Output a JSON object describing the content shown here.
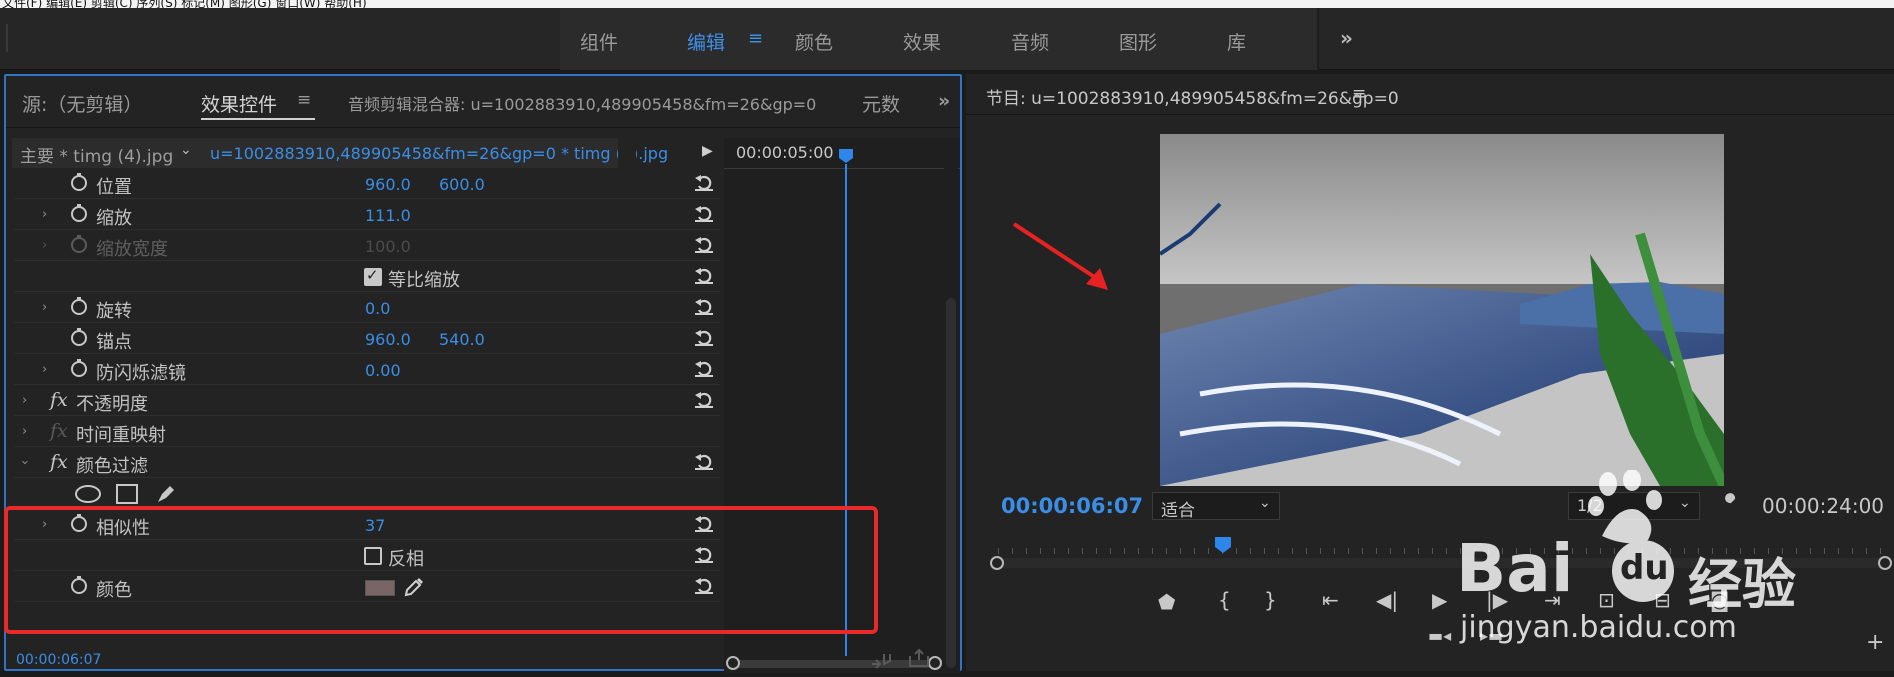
{
  "menubar": {
    "text": "文件(F) 编辑(E) 剪辑(C) 序列(S) 标记(M) 图形(G) 窗口(W) 帮助(H)"
  },
  "workspaces": [
    {
      "label": "组件"
    },
    {
      "label": "编辑",
      "active": true
    },
    {
      "label": "颜色"
    },
    {
      "label": "效果"
    },
    {
      "label": "音频"
    },
    {
      "label": "图形"
    },
    {
      "label": "库"
    }
  ],
  "left_panel": {
    "tabs": {
      "source": "源:（无剪辑）",
      "effect_controls": "效果控件",
      "audio_mixer": "音频剪辑混合器: u=1002883910,489905458&fm=26&gp=0",
      "metadata": "元数"
    },
    "clip": {
      "master": "主要 * timg (4).jpg",
      "sequence": "u=1002883910,489905458&fm=26&gp=0 * timg (4).jpg"
    },
    "timeline_time": "00:00:05:00",
    "rows": [
      {
        "label": "位置",
        "v1": "960.0",
        "v2": "600.0"
      },
      {
        "label": "缩放",
        "v1": "111.0"
      },
      {
        "label": "缩放宽度",
        "v1": "100.0"
      },
      {
        "checkbox_label": "等比缩放"
      },
      {
        "label": "旋转",
        "v1": "0.0"
      },
      {
        "label": "锚点",
        "v1": "960.0",
        "v2": "540.0"
      },
      {
        "label": "防闪烁滤镜",
        "v1": "0.00"
      },
      {
        "label": "不透明度"
      },
      {
        "label": "时间重映射"
      },
      {
        "label": "颜色过滤"
      },
      {},
      {
        "label": "相似性",
        "v1": "37"
      },
      {
        "checkbox_label": "反相"
      },
      {
        "label": "颜色",
        "color": "#7a6565"
      }
    ],
    "current_time": "00:00:06:07"
  },
  "program": {
    "title": "节目: u=1002883910,489905458&fm=26&gp=0",
    "current_time": "00:00:06:07",
    "fit": "适合",
    "resolution": "1/2",
    "duration": "00:00:24:00"
  },
  "watermark": {
    "brand": "Bai",
    "mid": "du",
    "cn": "经验",
    "url": "jingyan.baidu.com"
  },
  "colors": {
    "accent": "#3f8fe5",
    "highlight_box": "#ea2a2a",
    "panel_border": "#2f74c7"
  }
}
